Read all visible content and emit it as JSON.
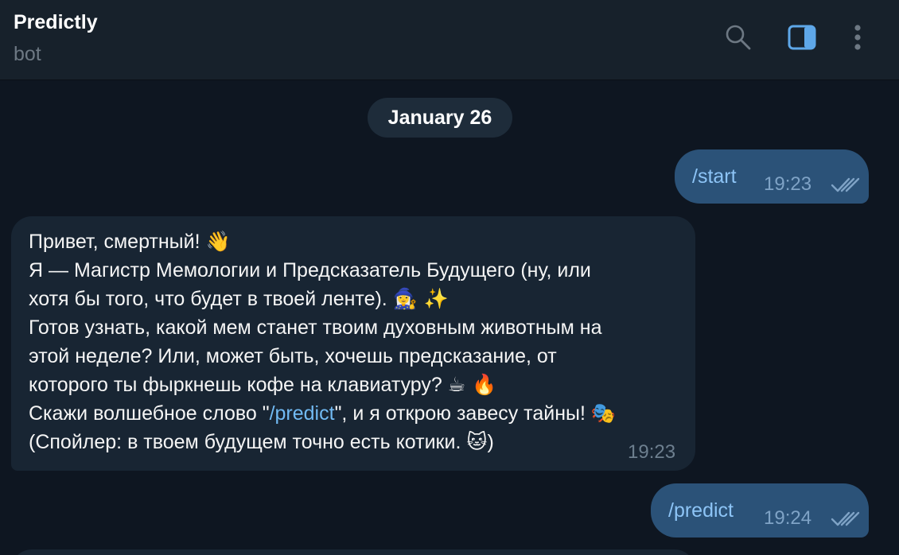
{
  "header": {
    "title": "Predictly",
    "subtitle": "bot",
    "icons": [
      "search-icon",
      "sidebar-toggle-icon",
      "more-vertical-icon"
    ]
  },
  "chat": {
    "date_label": "January 26",
    "messages": [
      {
        "direction": "outgoing",
        "text": "/start",
        "time": "19:23",
        "status": "read"
      },
      {
        "direction": "incoming",
        "lines": [
          {
            "text": "Привет, смертный!",
            "emoji": "👋"
          },
          {
            "text": "Я — Магистр Мемологии и Предсказатель Будущего (ну, или"
          },
          {
            "text": "хотя бы того, что будет в твоей ленте).",
            "emoji": "🧙‍♀️ ✨"
          },
          {
            "text": "Готов узнать, какой мем станет твоим духовным животным на"
          },
          {
            "text": "этой неделе? Или, может быть, хочешь предсказание, от"
          },
          {
            "text": "которого ты фыркнешь кофе на клавиатуру?",
            "emoji": "☕ 🔥"
          },
          {
            "prefix": "Скажи волшебное слово \"",
            "link": "/predict",
            "suffix": "\", и я открою завесу тайны!",
            "emoji": "🎭"
          },
          {
            "text": "(Спойлер: в твоем будущем точно есть котики.",
            "emoji": "🐱",
            "after": ")"
          }
        ],
        "time": "19:23"
      },
      {
        "direction": "outgoing",
        "text": "/predict",
        "time": "19:24",
        "status": "read"
      }
    ]
  },
  "colors": {
    "background": "#0e1621",
    "header": "#17212b",
    "outgoing_bubble": "#2b5278",
    "incoming_bubble": "#182533",
    "link": "#71baf3"
  }
}
